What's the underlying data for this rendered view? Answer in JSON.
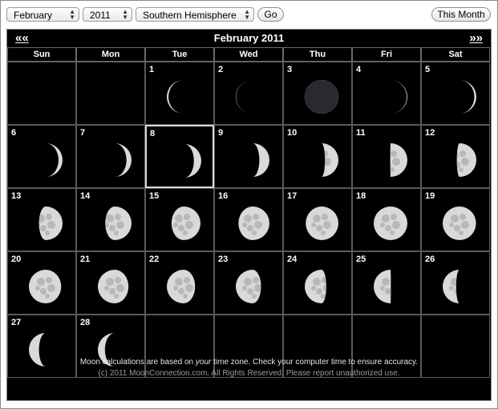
{
  "controls": {
    "month": "February",
    "year": "2011",
    "hemisphere": "Southern Hemisphere",
    "go_label": "Go",
    "this_month_label": "This Month"
  },
  "calendar": {
    "title": "February 2011",
    "prev_label": "««",
    "next_label": "»»",
    "weekdays": [
      "Sun",
      "Mon",
      "Tue",
      "Wed",
      "Thu",
      "Fri",
      "Sat"
    ],
    "today": 8,
    "weeks": [
      [
        null,
        null,
        {
          "day": "1",
          "illum": 0.05,
          "lit": "left"
        },
        {
          "day": "2",
          "illum": 0.01,
          "lit": "left"
        },
        {
          "day": "3",
          "illum": 0.0,
          "lit": "none"
        },
        {
          "day": "4",
          "illum": 0.02,
          "lit": "right"
        },
        {
          "day": "5",
          "illum": 0.06,
          "lit": "right"
        }
      ],
      [
        {
          "day": "6",
          "illum": 0.12,
          "lit": "right"
        },
        {
          "day": "7",
          "illum": 0.15,
          "lit": "right"
        },
        {
          "day": "8",
          "illum": 0.22,
          "lit": "right"
        },
        {
          "day": "9",
          "illum": 0.3,
          "lit": "right"
        },
        {
          "day": "10",
          "illum": 0.4,
          "lit": "right"
        },
        {
          "day": "11",
          "illum": 0.5,
          "lit": "right"
        },
        {
          "day": "12",
          "illum": 0.58,
          "lit": "right"
        }
      ],
      [
        {
          "day": "13",
          "illum": 0.7,
          "lit": "right"
        },
        {
          "day": "14",
          "illum": 0.78,
          "lit": "right"
        },
        {
          "day": "15",
          "illum": 0.86,
          "lit": "right"
        },
        {
          "day": "16",
          "illum": 0.92,
          "lit": "right"
        },
        {
          "day": "17",
          "illum": 0.97,
          "lit": "right"
        },
        {
          "day": "18",
          "illum": 1.0,
          "lit": "full"
        },
        {
          "day": "19",
          "illum": 0.99,
          "lit": "left"
        }
      ],
      [
        {
          "day": "20",
          "illum": 0.96,
          "lit": "left"
        },
        {
          "day": "21",
          "illum": 0.91,
          "lit": "left"
        },
        {
          "day": "22",
          "illum": 0.84,
          "lit": "left"
        },
        {
          "day": "23",
          "illum": 0.75,
          "lit": "left"
        },
        {
          "day": "24",
          "illum": 0.64,
          "lit": "left"
        },
        {
          "day": "25",
          "illum": 0.5,
          "lit": "left"
        },
        {
          "day": "26",
          "illum": 0.4,
          "lit": "left"
        }
      ],
      [
        {
          "day": "27",
          "illum": 0.3,
          "lit": "left"
        },
        {
          "day": "28",
          "illum": 0.21,
          "lit": "left"
        },
        null,
        null,
        null,
        null,
        null
      ]
    ]
  },
  "footer": {
    "note_prefix": "Moon calculations are based on ",
    "note_emphasis": "your",
    "note_suffix": " time zone. Check your computer time to ensure accuracy.",
    "copyright": "(c) 2011 MoonConnection.com. All Rights Reserved. Please report unauthorized use."
  },
  "colors": {
    "background": "#000000",
    "moon_light": "#d9d9d9",
    "moon_dark": "#2a2a2e"
  }
}
